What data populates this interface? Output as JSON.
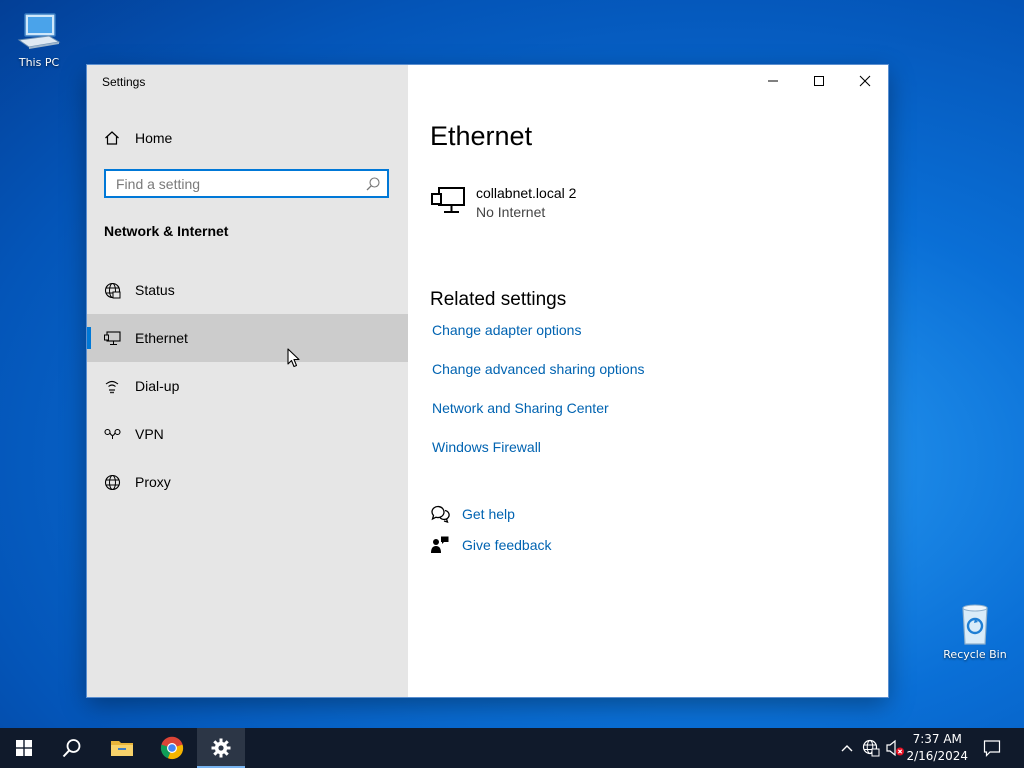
{
  "desktop": {
    "this_pc": "This PC",
    "recycle_bin": "Recycle Bin"
  },
  "window": {
    "title": "Settings",
    "controls": [
      "minimize",
      "maximize",
      "close"
    ]
  },
  "sidebar": {
    "home": "Home",
    "search_placeholder": "Find a setting",
    "section": "Network & Internet",
    "items": [
      {
        "label": "Status",
        "icon": "globe-status-icon"
      },
      {
        "label": "Ethernet",
        "icon": "ethernet-icon",
        "selected": true
      },
      {
        "label": "Dial-up",
        "icon": "dialup-icon"
      },
      {
        "label": "VPN",
        "icon": "vpn-icon"
      },
      {
        "label": "Proxy",
        "icon": "globe-icon"
      }
    ]
  },
  "content": {
    "title": "Ethernet",
    "network": {
      "name": "collabnet.local 2",
      "status": "No Internet"
    },
    "related_heading": "Related settings",
    "related_links": [
      "Change adapter options",
      "Change advanced sharing options",
      "Network and Sharing Center",
      "Windows Firewall"
    ],
    "help": {
      "get_help": "Get help",
      "give_feedback": "Give feedback"
    }
  },
  "taskbar": {
    "time": "7:37 AM",
    "date": "2/16/2024"
  },
  "colors": {
    "accent": "#0078d7",
    "link": "#0063b1",
    "sidebar_bg": "#e6e6e6",
    "selected_bg": "#cccccc",
    "taskbar_bg": "#101a2b"
  }
}
